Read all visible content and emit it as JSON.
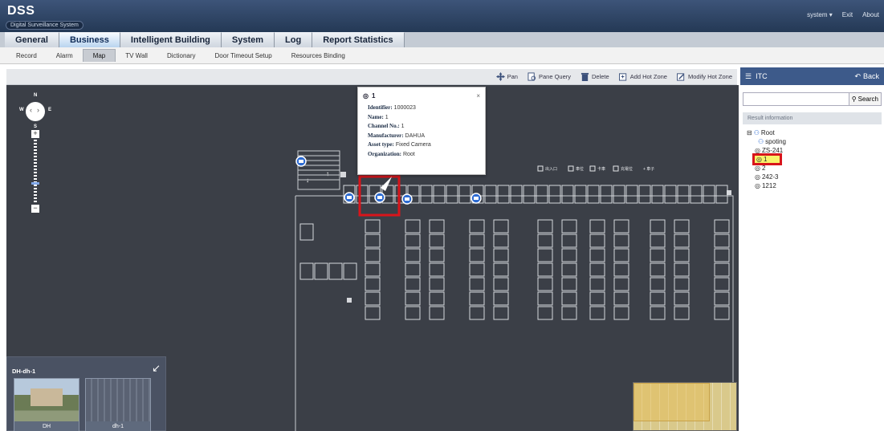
{
  "header": {
    "logo": "DSS",
    "subtitle": "Digital Surveillance System",
    "links": [
      "system ▾",
      "Exit",
      "About"
    ]
  },
  "main_tabs": [
    "General",
    "Business",
    "Intelligent Building",
    "System",
    "Log",
    "Report Statistics"
  ],
  "sub_tabs": [
    "Record",
    "Alarm",
    "Map",
    "TV Wall",
    "Dictionary",
    "Door Timeout Setup",
    "Resources Binding"
  ],
  "toolbar": {
    "items": [
      {
        "label": "Pan",
        "icon": "pan-icon"
      },
      {
        "label": "Pane Query",
        "icon": "pane-query-icon"
      },
      {
        "label": "Delete",
        "icon": "delete-icon"
      },
      {
        "label": "Add Hot Zone",
        "icon": "add-hot-zone-icon"
      },
      {
        "label": "Modify Hot Zone",
        "icon": "modify-hot-zone-icon"
      }
    ]
  },
  "compass": {
    "north": "N",
    "south": "S",
    "west": "W",
    "east": "E"
  },
  "popup": {
    "title": "1",
    "close": "×",
    "rows": [
      {
        "label": "Identifier:",
        "value": "1000023"
      },
      {
        "label": "Name:",
        "value": "1"
      },
      {
        "label": "Channel No.:",
        "value": "1"
      },
      {
        "label": "Manufacturer:",
        "value": "DAHUA"
      },
      {
        "label": "Asset type:",
        "value": "Fixed Camera"
      },
      {
        "label": "Organization:",
        "value": "Root"
      }
    ]
  },
  "right_panel": {
    "title": "ITC",
    "back": "Back",
    "search_button": "Search",
    "search_value": "",
    "result_label": "Result information",
    "tree": {
      "root": "Root",
      "children": [
        "spoting",
        "ZS-241",
        "1",
        "2",
        "242-3",
        "1212"
      ]
    }
  },
  "overview": {
    "title": "DH-dh-1",
    "thumbnails": [
      "DH",
      "dh-1"
    ]
  },
  "colors": {
    "header": "#2d4263",
    "map_bg": "#3b3f47",
    "highlight": "#d8151b",
    "panel_header": "#3d5a8a"
  }
}
